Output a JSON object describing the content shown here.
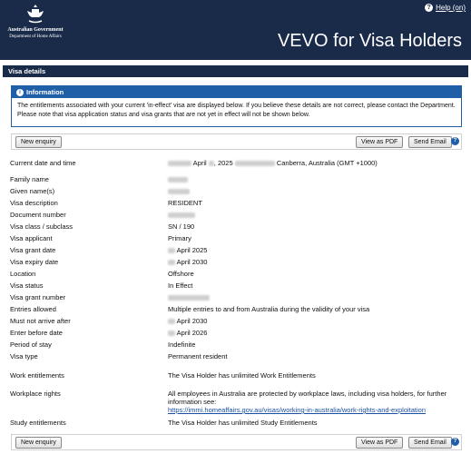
{
  "header": {
    "logo_line1": "Australian Government",
    "logo_line2": "Department of Home Affairs",
    "help_icon": "help-icon",
    "help_label": "Help (on)",
    "title": "VEVO for Visa Holders"
  },
  "section_title": "Visa details",
  "info": {
    "title": "Information",
    "text": "The entitlements associated with your current 'in-effect' visa are displayed below. If you believe these details are not correct, please contact the Department. Please note that visa application status and visa grants that are not yet in effect will not be shown below."
  },
  "toolbar": {
    "new_enquiry": "New enquiry",
    "view_pdf": "View as PDF",
    "send_email": "Send Email",
    "help_icon": "question-icon"
  },
  "details": {
    "current_date": {
      "label": "Current date and time",
      "prefix": "April",
      "year": ", 2025",
      "suffix": "Canberra, Australia (GMT +1000)"
    },
    "family_name": {
      "label": "Family name"
    },
    "given_names": {
      "label": "Given name(s)"
    },
    "visa_description": {
      "label": "Visa description",
      "value": "RESIDENT"
    },
    "document_number": {
      "label": "Document number"
    },
    "visa_class": {
      "label": "Visa class / subclass",
      "value": "SN / 190"
    },
    "visa_applicant": {
      "label": "Visa applicant",
      "value": "Primary"
    },
    "visa_grant_date": {
      "label": "Visa grant date",
      "value": "April 2025"
    },
    "visa_expiry_date": {
      "label": "Visa expiry date",
      "value": "April 2030"
    },
    "location": {
      "label": "Location",
      "value": "Offshore"
    },
    "visa_status": {
      "label": "Visa status",
      "value": "In Effect"
    },
    "visa_grant_number": {
      "label": "Visa grant number"
    },
    "entries_allowed": {
      "label": "Entries allowed",
      "value": "Multiple entries to and from Australia during the validity of your visa"
    },
    "must_not_arrive_after": {
      "label": "Must not arrive after",
      "value": "April 2030"
    },
    "enter_before_date": {
      "label": "Enter before date",
      "value": "April 2026"
    },
    "period_of_stay": {
      "label": "Period of stay",
      "value": "Indefinite"
    },
    "visa_type": {
      "label": "Visa type",
      "value": "Permanent resident"
    },
    "work_entitlements": {
      "label": "Work entitlements",
      "value": "The Visa Holder has unlimited Work Entitlements"
    },
    "workplace_rights": {
      "label": "Workplace rights",
      "value": "All employees in Australia are protected by workplace laws, including visa holders, for further information see:",
      "link": "https://immi.homeaffairs.gov.au/visas/working-in-australia/work-rights-and-exploitation"
    },
    "study_entitlements": {
      "label": "Study entitlements",
      "value": "The Visa Holder has unlimited Study Entitlements"
    }
  }
}
